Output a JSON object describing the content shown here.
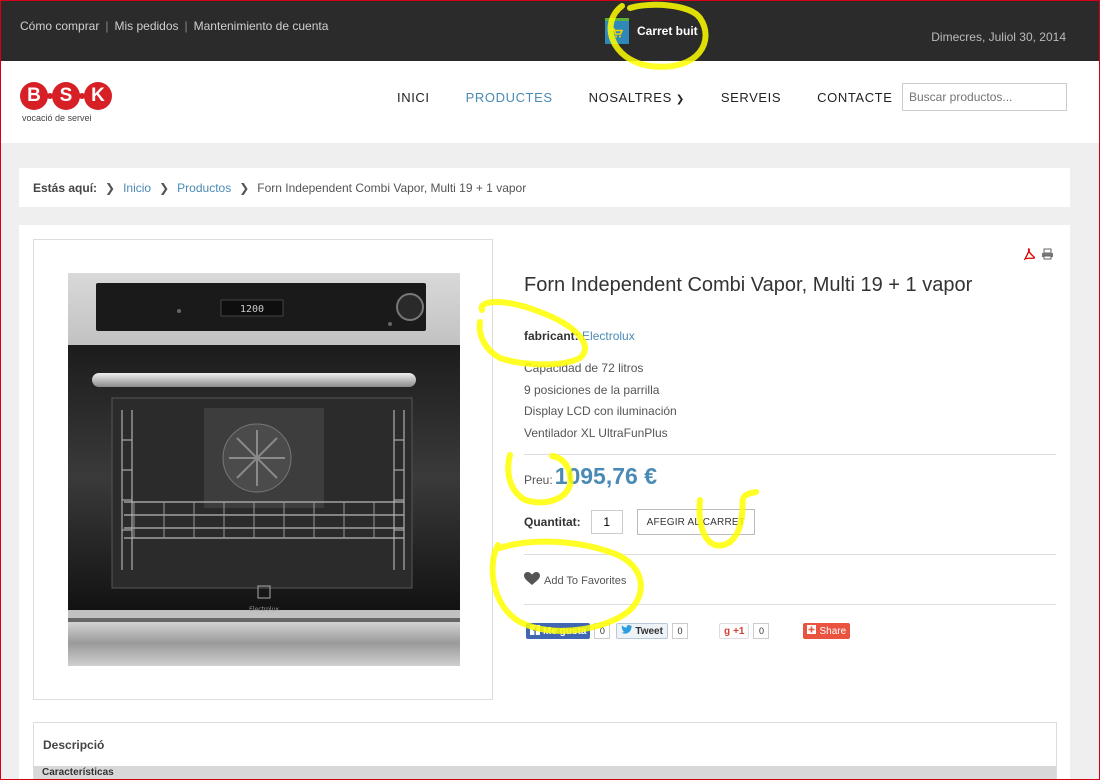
{
  "topbar": {
    "links": [
      "Cómo comprar",
      "Mis pedidos",
      "Mantenimiento de cuenta"
    ],
    "separator": "|",
    "cart_label": "Carret buit",
    "date": "Dimecres, Juliol 30, 2014"
  },
  "logo": {
    "letters": [
      "B",
      "S",
      "K"
    ],
    "tagline": "vocació de servei"
  },
  "nav": {
    "items": [
      {
        "label": "INICI",
        "active": false
      },
      {
        "label": "PRODUCTES",
        "active": true
      },
      {
        "label": "NOSALTRES",
        "active": false,
        "dropdown": true
      },
      {
        "label": "SERVEIS",
        "active": false
      },
      {
        "label": "CONTACTE",
        "active": false
      }
    ],
    "search_placeholder": "Buscar productos..."
  },
  "breadcrumb": {
    "label": "Estás aquí:",
    "items": [
      "Inicio",
      "Productos",
      "Forn Independent Combi Vapor, Multi 19 + 1 vapor"
    ]
  },
  "product": {
    "title": "Forn Independent Combi Vapor, Multi 19 + 1 vapor",
    "maker_label": "fabricant:",
    "maker": "Electrolux",
    "features": [
      "Capacidad de 72 litros",
      "9 posiciones de la parrilla",
      "Display LCD con iluminación",
      "Ventilador XL UltraFunPlus"
    ],
    "price_label": "Preu:",
    "price": "1095,76 €",
    "quantity_label": "Quantitat:",
    "quantity": "1",
    "add_to_cart": "AFEGIR AL CARRET",
    "favorites": "Add To Favorites",
    "oven_display": "1200",
    "oven_brand": "Electrolux"
  },
  "social": {
    "facebook": "Me gusta",
    "facebook_count": "0",
    "tweet": "Tweet",
    "tweet_count": "0",
    "gplus": "+1",
    "gplus_count": "0",
    "share": "Share"
  },
  "description": {
    "title": "Descripció",
    "subtitle": "Características"
  },
  "colors": {
    "accent": "#4a8ab5",
    "brand": "#d71f26",
    "topbar": "#2b2b2b",
    "highlight": "#ffff00"
  }
}
